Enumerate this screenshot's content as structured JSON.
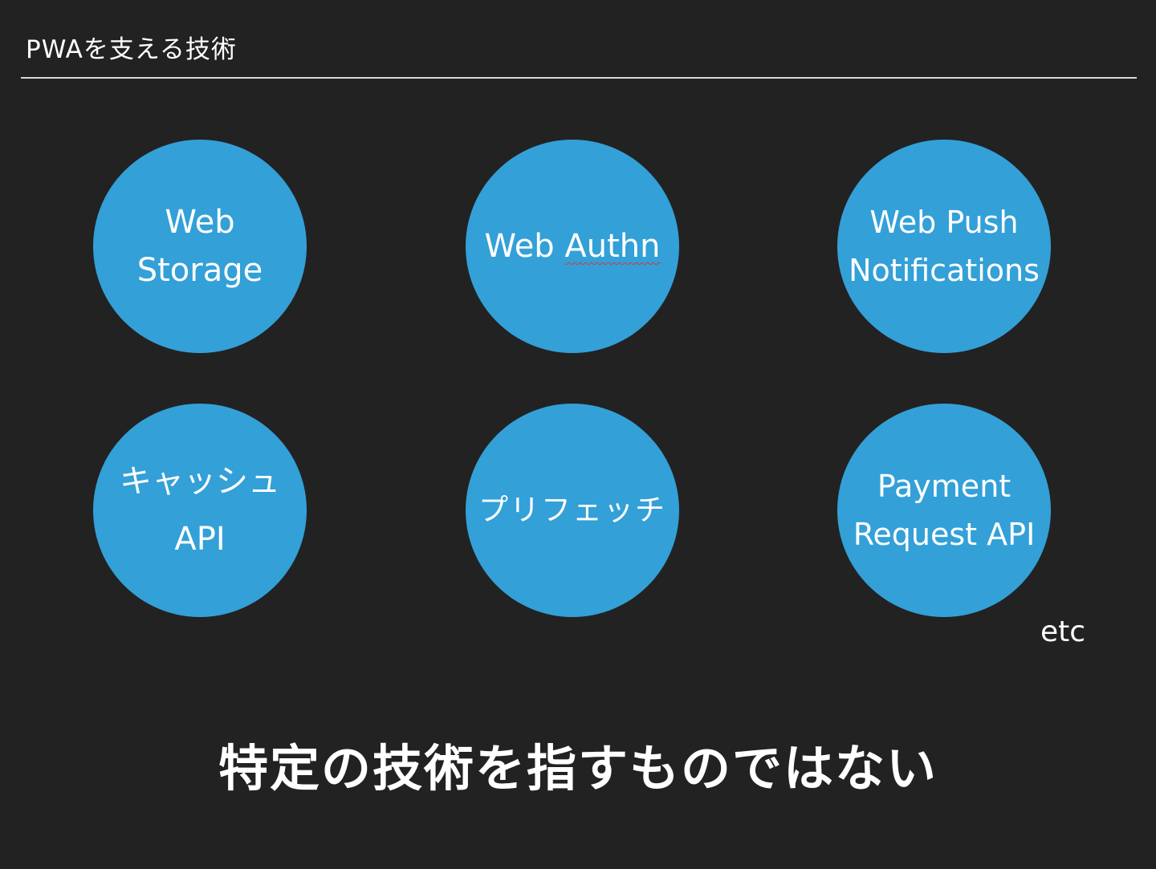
{
  "slide": {
    "title": "PWAを支える技術",
    "tagline": "特定の技術を指すものではない",
    "etc_label": "etc"
  },
  "technologies": [
    {
      "line1": "Web",
      "line2": "Storage"
    },
    {
      "line1": "Web ",
      "line1_underlined": "Authn"
    },
    {
      "line1": "Web Push",
      "line2": "Notifications"
    },
    {
      "line1": "キャッシュ",
      "line2": "API"
    },
    {
      "line1": "プリフェッチ"
    },
    {
      "line1": "Payment",
      "line2": "Request API"
    }
  ],
  "colors": {
    "background": "#222222",
    "circle_fill": "#33a0d8",
    "text": "#ffffff",
    "rule": "#d8d8d8",
    "spellcheck_underline": "#d23a3a"
  }
}
